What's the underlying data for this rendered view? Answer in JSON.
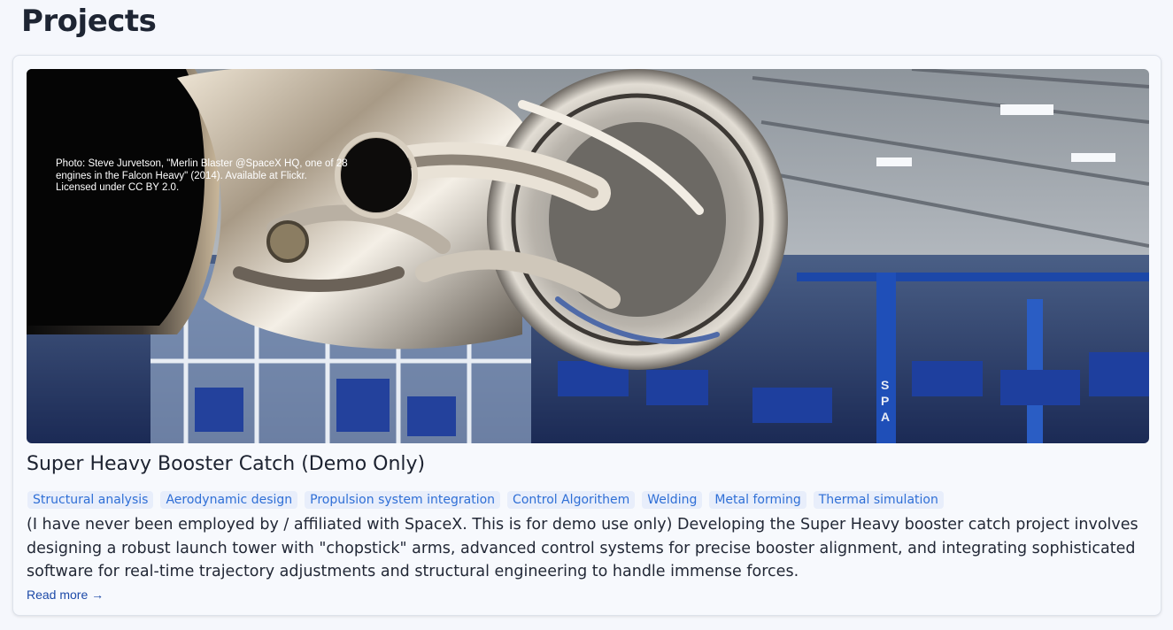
{
  "page": {
    "title": "Projects"
  },
  "project": {
    "image_alt": "Rocket engine in factory",
    "image_credit": [
      "Photo: Steve Jurvetson, \"Merlin Blaster @SpaceX HQ, one of 28",
      "engines in the Falcon Heavy\" (2014). Available at Flickr.",
      "Licensed under CC BY 2.0."
    ],
    "title": "Super Heavy Booster Catch (Demo Only)",
    "tags": [
      "Structural analysis",
      "Aerodynamic design",
      "Propulsion system integration",
      "Control Algorithem",
      "Welding",
      "Metal forming",
      "Thermal simulation"
    ],
    "description": "(I have never been employed by / affiliated with SpaceX. This is for demo use only) Developing the Super Heavy booster catch project involves designing a robust launch tower with \"chopstick\" arms, advanced control systems for precise booster alignment, and integrating sophisticated software for real-time trajectory adjustments and structural engineering to handle immense forces.",
    "read_more": "Read more →"
  },
  "colors": {
    "background": "#f5f7fc",
    "card": "#f7f9fd",
    "tag_bg": "#e8eefb",
    "tag_text": "#2f6fd6",
    "link": "#1d4aa8"
  }
}
